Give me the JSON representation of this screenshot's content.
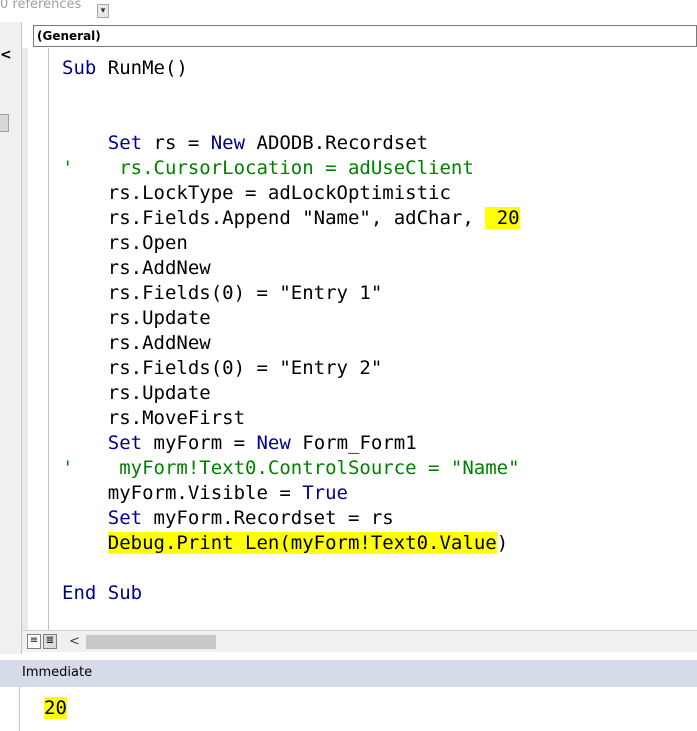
{
  "top": {
    "references_label": "0 references",
    "dropdown_glyph": "▾"
  },
  "left_gutter": {
    "arrow": "<"
  },
  "procedure_combo": {
    "value": "(General)"
  },
  "code": {
    "lines": [
      {
        "parts": [
          {
            "t": "Sub",
            "c": "kw"
          },
          {
            "t": " RunMe()"
          }
        ]
      },
      {
        "parts": []
      },
      {
        "parts": []
      },
      {
        "parts": [
          {
            "t": "    "
          },
          {
            "t": "Set",
            "c": "kw"
          },
          {
            "t": " rs = "
          },
          {
            "t": "New",
            "c": "kw"
          },
          {
            "t": " ADODB.Recordset"
          }
        ]
      },
      {
        "parts": [
          {
            "t": "'    rs.CursorLocation = adUseClient",
            "c": "cm"
          }
        ]
      },
      {
        "parts": [
          {
            "t": "    rs.LockType = adLockOptimistic"
          }
        ]
      },
      {
        "parts": [
          {
            "t": "    rs.Fields.Append \"Name\", adChar, "
          },
          {
            "t": " 20",
            "c": "hl"
          }
        ]
      },
      {
        "parts": [
          {
            "t": "    rs.Open"
          }
        ]
      },
      {
        "parts": [
          {
            "t": "    rs.AddNew"
          }
        ]
      },
      {
        "parts": [
          {
            "t": "    rs.Fields(0) = \"Entry 1\""
          }
        ]
      },
      {
        "parts": [
          {
            "t": "    rs.Update"
          }
        ]
      },
      {
        "parts": [
          {
            "t": "    rs.AddNew"
          }
        ]
      },
      {
        "parts": [
          {
            "t": "    rs.Fields(0) = \"Entry 2\""
          }
        ]
      },
      {
        "parts": [
          {
            "t": "    rs.Update"
          }
        ]
      },
      {
        "parts": [
          {
            "t": "    rs.MoveFirst"
          }
        ]
      },
      {
        "parts": [
          {
            "t": "    "
          },
          {
            "t": "Set",
            "c": "kw"
          },
          {
            "t": " myForm = "
          },
          {
            "t": "New",
            "c": "kw"
          },
          {
            "t": " Form_Form1"
          }
        ]
      },
      {
        "parts": [
          {
            "t": "'    myForm!Text0.ControlSource = \"Name\"",
            "c": "cm"
          }
        ]
      },
      {
        "parts": [
          {
            "t": "    myForm.Visible = "
          },
          {
            "t": "True",
            "c": "kw"
          }
        ]
      },
      {
        "parts": [
          {
            "t": "    "
          },
          {
            "t": "Set",
            "c": "kw"
          },
          {
            "t": " myForm.Recordset = rs"
          }
        ]
      },
      {
        "parts": [
          {
            "t": "    "
          },
          {
            "t": "Debug.Print Len(myForm!Text0.Value",
            "c": "hl"
          },
          {
            "t": ")"
          }
        ]
      },
      {
        "parts": []
      },
      {
        "parts": [
          {
            "t": "End Sub",
            "c": "kw"
          }
        ]
      }
    ]
  },
  "view_buttons": {
    "procedure_view": "≡",
    "full_module_view": "≣",
    "scroll_left": "<"
  },
  "immediate": {
    "title": "Immediate",
    "output": "20"
  },
  "colors": {
    "keyword": "#00008b",
    "comment": "#008000",
    "highlight": "#ffff00",
    "immediate_header": "#d6dbe9"
  }
}
